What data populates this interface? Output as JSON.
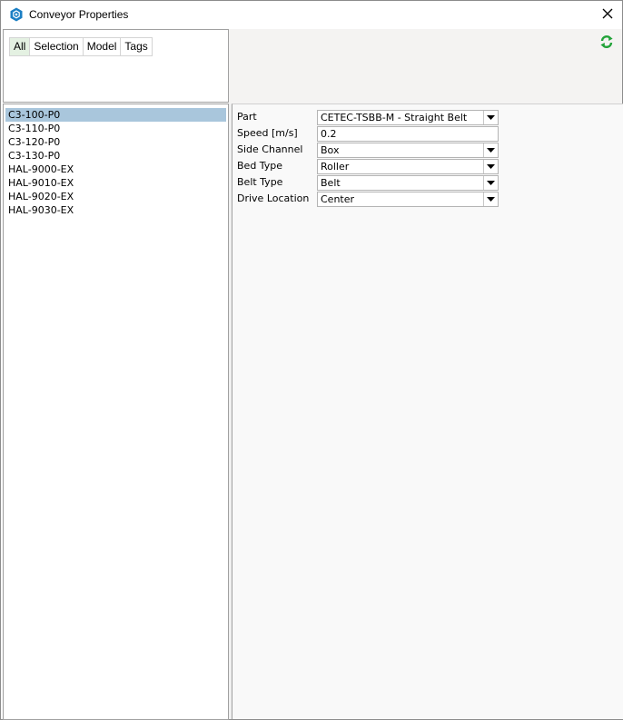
{
  "window": {
    "title": "Conveyor Properties",
    "close_icon": "close-icon",
    "app_icon": "conveyor-hex-icon"
  },
  "filter": {
    "tabs": [
      {
        "label": "All",
        "active": true
      },
      {
        "label": "Selection",
        "active": false
      },
      {
        "label": "Model",
        "active": false
      },
      {
        "label": "Tags",
        "active": false
      }
    ]
  },
  "toolbar": {
    "refresh_icon": "refresh-icon"
  },
  "items": [
    {
      "label": "C3-100-P0",
      "selected": true
    },
    {
      "label": "C3-110-P0",
      "selected": false
    },
    {
      "label": "C3-120-P0",
      "selected": false
    },
    {
      "label": "C3-130-P0",
      "selected": false
    },
    {
      "label": "HAL-9000-EX",
      "selected": false
    },
    {
      "label": "HAL-9010-EX",
      "selected": false
    },
    {
      "label": "HAL-9020-EX",
      "selected": false
    },
    {
      "label": "HAL-9030-EX",
      "selected": false
    }
  ],
  "properties": [
    {
      "label": "Part",
      "value": "CETEC-TSBB-M - Straight Belt",
      "type": "dropdown"
    },
    {
      "label": "Speed [m/s]",
      "value": "0.2",
      "type": "text"
    },
    {
      "label": "Side Channel",
      "value": "Box",
      "type": "dropdown"
    },
    {
      "label": "Bed Type",
      "value": "Roller",
      "type": "dropdown"
    },
    {
      "label": "Belt Type",
      "value": "Belt",
      "type": "dropdown"
    },
    {
      "label": "Drive Location",
      "value": "Center",
      "type": "dropdown"
    }
  ],
  "colors": {
    "accent": "#1b7fc4",
    "selection": "#a9c6dc",
    "active_tab": "#e4f1e2",
    "refresh_green": "#23a33a"
  }
}
